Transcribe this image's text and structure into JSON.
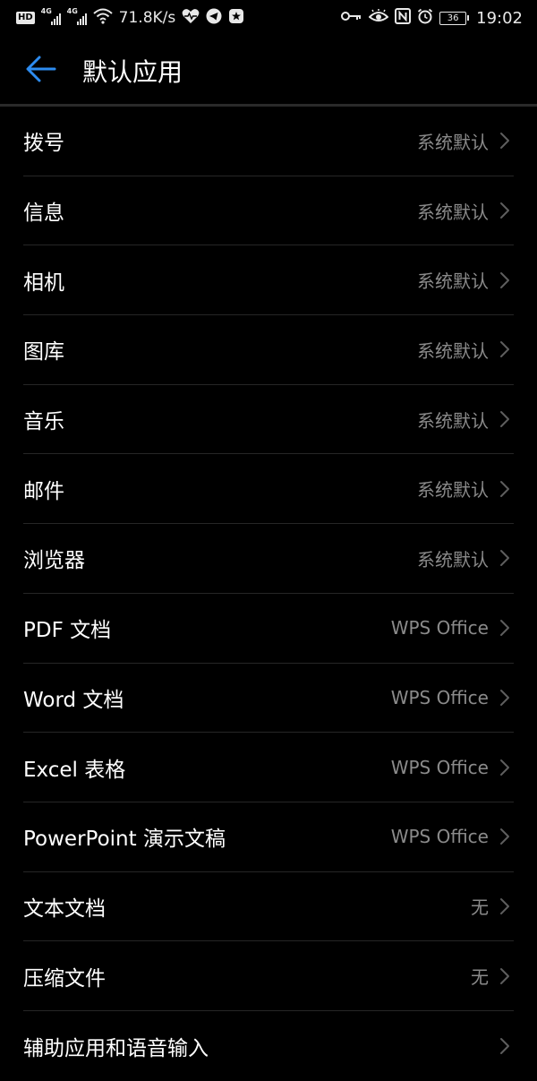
{
  "status_bar": {
    "hd_badge": "HD",
    "sim1_gen": "4G",
    "sim2_gen": "4G",
    "net_speed": "71.8K/s",
    "battery_level": "36",
    "time": "19:02"
  },
  "header": {
    "title": "默认应用",
    "back_icon": "arrow-left-icon",
    "accent_color": "#2d8cf0"
  },
  "items": [
    {
      "label": "拨号",
      "value": "系统默认"
    },
    {
      "label": "信息",
      "value": "系统默认"
    },
    {
      "label": "相机",
      "value": "系统默认"
    },
    {
      "label": "图库",
      "value": "系统默认"
    },
    {
      "label": "音乐",
      "value": "系统默认"
    },
    {
      "label": "邮件",
      "value": "系统默认"
    },
    {
      "label": "浏览器",
      "value": "系统默认"
    },
    {
      "label": "PDF 文档",
      "value": "WPS Office"
    },
    {
      "label": "Word 文档",
      "value": "WPS Office"
    },
    {
      "label": "Excel 表格",
      "value": "WPS Office"
    },
    {
      "label": "PowerPoint 演示文稿",
      "value": "WPS Office"
    },
    {
      "label": "文本文档",
      "value": "无"
    },
    {
      "label": "压缩文件",
      "value": "无"
    },
    {
      "label": "辅助应用和语音输入",
      "value": ""
    }
  ]
}
